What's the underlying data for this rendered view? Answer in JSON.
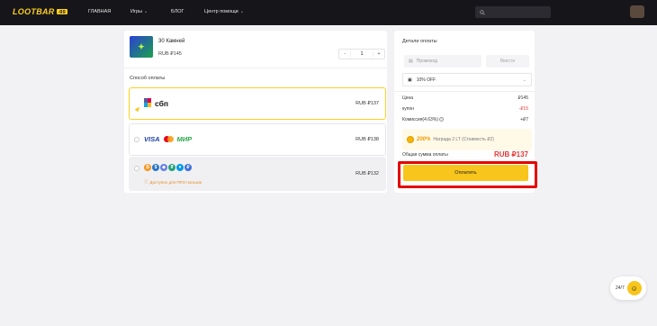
{
  "header": {
    "logo_text": "LOOTBAR",
    "logo_tag": ".gg",
    "nav": [
      {
        "label": "ГЛАВНАЯ"
      },
      {
        "label": "Игры"
      },
      {
        "label": "БЛОГ"
      },
      {
        "label": "Центр помощи"
      }
    ],
    "search_placeholder": "",
    "signin_text": ""
  },
  "product": {
    "name": "30 Камней",
    "price": "RUB ₽145",
    "quantity": "1",
    "minus": "-",
    "plus": "+"
  },
  "payment": {
    "title": "Способ оплаты",
    "methods": [
      {
        "name": "sbp",
        "logo_text": "сбп",
        "price": "RUB ₽137",
        "selected": true
      },
      {
        "name": "cards",
        "visa": "VISA",
        "mir": "МИР",
        "price": "RUB ₽138",
        "selected": false
      },
      {
        "name": "crypto",
        "price": "RUB ₽132",
        "note": "Доступно для ПРО пользов",
        "selected": false
      }
    ]
  },
  "details": {
    "title": "Детали оплаты",
    "promo_placeholder": "Промокод",
    "promo_button": "Ввести",
    "coupon": "10% OFF",
    "rows": [
      {
        "label": "Цена",
        "value": "₽145"
      },
      {
        "label": "купон",
        "value": "-₽15"
      },
      {
        "label": "Комиссия(4.63%)",
        "value": "+₽7"
      }
    ],
    "reward_pct": "200%",
    "reward_text": "Награда 2 LT (Стоимость ₽2)",
    "total_label": "Общая сумма оплаты",
    "total_value": "RUB ₽137",
    "pay_button": "Оплатить"
  },
  "support": {
    "label": "24/7"
  },
  "colors": {
    "accent": "#F8C51C",
    "danger": "#E53935",
    "header_bg": "#16161A",
    "highlight": "#E60000"
  },
  "icons": [
    "search-icon",
    "chevron-down-icon",
    "ticket-icon",
    "coupon-icon",
    "info-icon",
    "support-icon"
  ]
}
